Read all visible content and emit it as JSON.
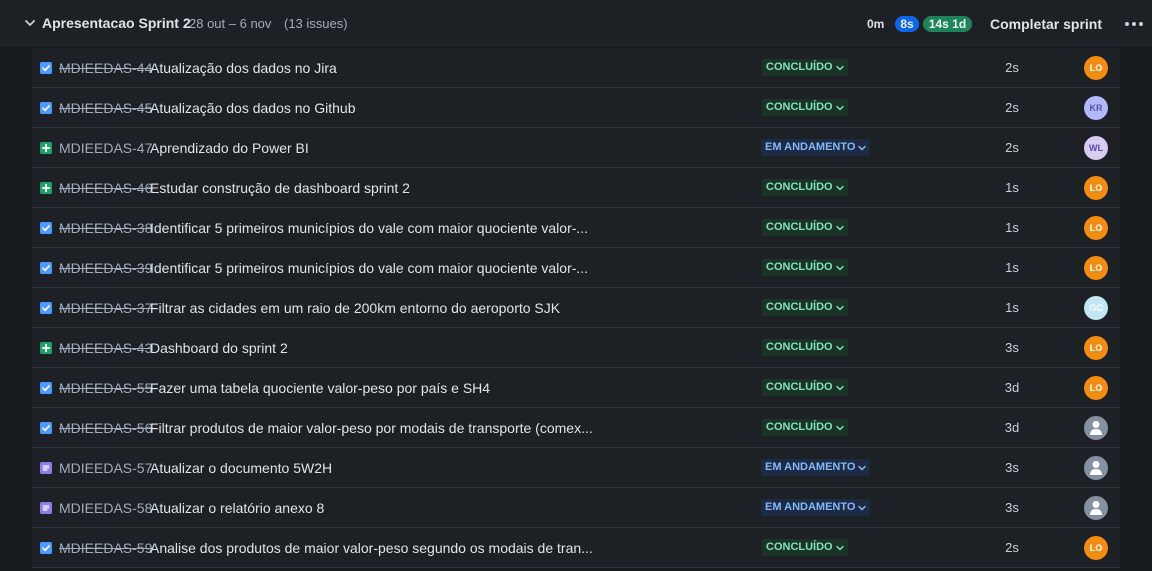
{
  "sprint": {
    "name": "Apresentacao Sprint 2",
    "dates": "28 out – 6 nov",
    "issue_count": "(13 issues)",
    "estimate_todo": "0m",
    "estimate_in_progress": "8s",
    "estimate_done": "14s 1d",
    "complete_label": "Completar sprint"
  },
  "issues": [
    {
      "type": "task",
      "key": "MDIEEDAS-44",
      "title": "Atualização dos dados no Jira",
      "status": "CONCLUÍDO",
      "status_kind": "done",
      "estimate": "2s",
      "assignee": "LO",
      "avatar_color": "#f18d13",
      "avatar_text": "#ffffff"
    },
    {
      "type": "task",
      "key": "MDIEEDAS-45",
      "title": "Atualização dos dados no Github",
      "status": "CONCLUÍDO",
      "status_kind": "done",
      "estimate": "2s",
      "assignee": "KR",
      "avatar_color": "#b3b9f8",
      "avatar_text": "#5e4db2"
    },
    {
      "type": "story",
      "key": "MDIEEDAS-47",
      "title": "Aprendizado do Power BI",
      "status": "EM ANDAMENTO",
      "status_kind": "prog",
      "estimate": "2s",
      "assignee": "WL",
      "avatar_color": "#d8ccf1",
      "avatar_text": "#5e4db2"
    },
    {
      "type": "story",
      "key": "MDIEEDAS-46",
      "title": "Estudar construção de dashboard sprint 2",
      "status": "CONCLUÍDO",
      "status_kind": "done",
      "estimate": "1s",
      "assignee": "LO",
      "avatar_color": "#f18d13",
      "avatar_text": "#ffffff"
    },
    {
      "type": "task",
      "key": "MDIEEDAS-38",
      "title": "Identificar 5 primeiros municípios do vale com maior quociente valor-...",
      "status": "CONCLUÍDO",
      "status_kind": "done",
      "estimate": "1s",
      "assignee": "LO",
      "avatar_color": "#f18d13",
      "avatar_text": "#ffffff"
    },
    {
      "type": "task",
      "key": "MDIEEDAS-39",
      "title": "Identificar 5 primeiros municípios do vale com maior quociente valor-...",
      "status": "CONCLUÍDO",
      "status_kind": "done",
      "estimate": "1s",
      "assignee": "LO",
      "avatar_color": "#f18d13",
      "avatar_text": "#ffffff"
    },
    {
      "type": "task",
      "key": "MDIEEDAS-37",
      "title": "Filtrar as cidades em um raio de 200km entorno do aeroporto SJK",
      "status": "CONCLUÍDO",
      "status_kind": "done",
      "estimate": "1s",
      "assignee": "GC",
      "avatar_color": "#c1e7f6",
      "avatar_text": "#ffffff"
    },
    {
      "type": "story",
      "key": "MDIEEDAS-43",
      "title": "Dashboard do sprint 2",
      "status": "CONCLUÍDO",
      "status_kind": "done",
      "estimate": "3s",
      "assignee": "LO",
      "avatar_color": "#f18d13",
      "avatar_text": "#ffffff"
    },
    {
      "type": "task",
      "key": "MDIEEDAS-55",
      "title": "Fazer uma tabela quociente valor-peso por país e SH4",
      "status": "CONCLUÍDO",
      "status_kind": "done",
      "estimate": "3d",
      "assignee": "LO",
      "avatar_color": "#f18d13",
      "avatar_text": "#ffffff"
    },
    {
      "type": "task",
      "key": "MDIEEDAS-56",
      "title": "Filtrar produtos de maior valor-peso por modais de transporte (comex...",
      "status": "CONCLUÍDO",
      "status_kind": "done",
      "estimate": "3d",
      "assignee": "",
      "avatar_color": "#8590a2",
      "avatar_text": "#ffffff"
    },
    {
      "type": "sub",
      "key": "MDIEEDAS-57",
      "title": "Atualizar o documento 5W2H",
      "status": "EM ANDAMENTO",
      "status_kind": "prog",
      "estimate": "3s",
      "assignee": "",
      "avatar_color": "#8590a2",
      "avatar_text": "#ffffff"
    },
    {
      "type": "sub",
      "key": "MDIEEDAS-58",
      "title": "Atualizar o relatório anexo 8",
      "status": "EM ANDAMENTO",
      "status_kind": "prog",
      "estimate": "3s",
      "assignee": "",
      "avatar_color": "#8590a2",
      "avatar_text": "#ffffff"
    },
    {
      "type": "task",
      "key": "MDIEEDAS-59",
      "title": "Analise dos produtos de maior valor-peso segundo os modais de tran...",
      "status": "CONCLUÍDO",
      "status_kind": "done",
      "estimate": "2s",
      "assignee": "LO",
      "avatar_color": "#f18d13",
      "avatar_text": "#ffffff"
    }
  ]
}
